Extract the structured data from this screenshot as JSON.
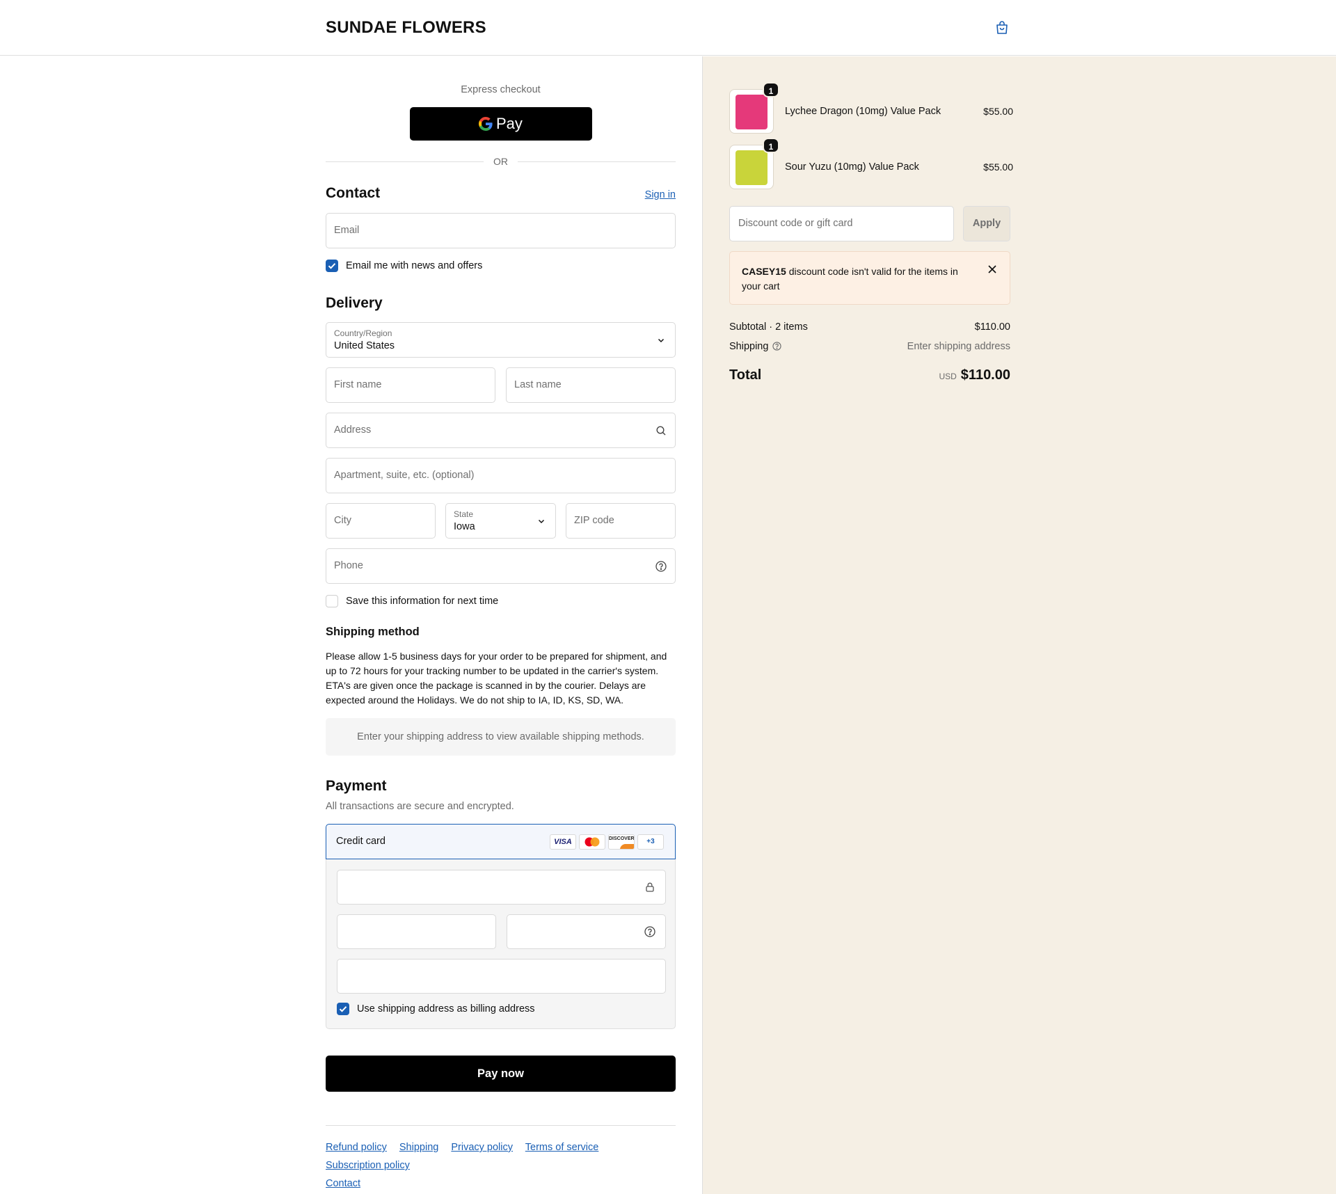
{
  "header": {
    "brand": "SUNDAE FLOWERS",
    "cart_icon": "shopping-bag-icon"
  },
  "express": {
    "label": "Express checkout",
    "gpay_label": "Pay",
    "or": "OR"
  },
  "contact": {
    "title": "Contact",
    "sign_in": "Sign in",
    "email_placeholder": "Email",
    "newsletter_label": "Email me with news and offers",
    "newsletter_checked": true
  },
  "delivery": {
    "title": "Delivery",
    "country_label": "Country/Region",
    "country_value": "United States",
    "first_name_placeholder": "First name",
    "last_name_placeholder": "Last name",
    "address_placeholder": "Address",
    "apartment_placeholder": "Apartment, suite, etc. (optional)",
    "city_placeholder": "City",
    "state_label": "State",
    "state_value": "Iowa",
    "zip_placeholder": "ZIP code",
    "phone_placeholder": "Phone",
    "save_info_label": "Save this information for next time",
    "save_info_checked": false
  },
  "shipping_method": {
    "title": "Shipping method",
    "description": "Please allow 1-5 business days for your order to be prepared for shipment, and up to 72 hours for your tracking number to be updated in the carrier's system. ETA's are given once the package is scanned in by the courier. Delays are expected around the Holidays. We do not ship to IA, ID, KS, SD, WA.",
    "empty_notice": "Enter your shipping address to view available shipping methods."
  },
  "payment": {
    "title": "Payment",
    "subtitle": "All transactions are secure and encrypted.",
    "method_label": "Credit card",
    "card_brands": [
      "VISA",
      "",
      "DISCOVER",
      "+3"
    ],
    "billing_same_label": "Use shipping address as billing address",
    "billing_same_checked": true,
    "pay_button": "Pay now"
  },
  "footer": {
    "links": [
      "Refund policy",
      "Shipping",
      "Privacy policy",
      "Terms of service",
      "Subscription policy",
      "Contact"
    ]
  },
  "summary": {
    "items": [
      {
        "name": "Lychee Dragon (10mg) Value Pack",
        "price": "$55.00",
        "qty": "1",
        "color": "#e5397a"
      },
      {
        "name": "Sour Yuzu (10mg) Value Pack",
        "price": "$55.00",
        "qty": "1",
        "color": "#c9d43a"
      }
    ],
    "discount_placeholder": "Discount code or gift card",
    "apply_label": "Apply",
    "error_code": "CASEY15",
    "error_message": " discount code isn't valid for the items in your cart",
    "subtotal_label": "Subtotal · 2 items",
    "subtotal_value": "$110.00",
    "shipping_label": "Shipping",
    "shipping_value": "Enter shipping address",
    "total_label": "Total",
    "total_currency": "USD",
    "total_value": "$110.00"
  },
  "colors": {
    "accent": "#1a5fb4",
    "sidebar_bg": "#f5efe4",
    "notice_bg": "#fdf0e4"
  }
}
